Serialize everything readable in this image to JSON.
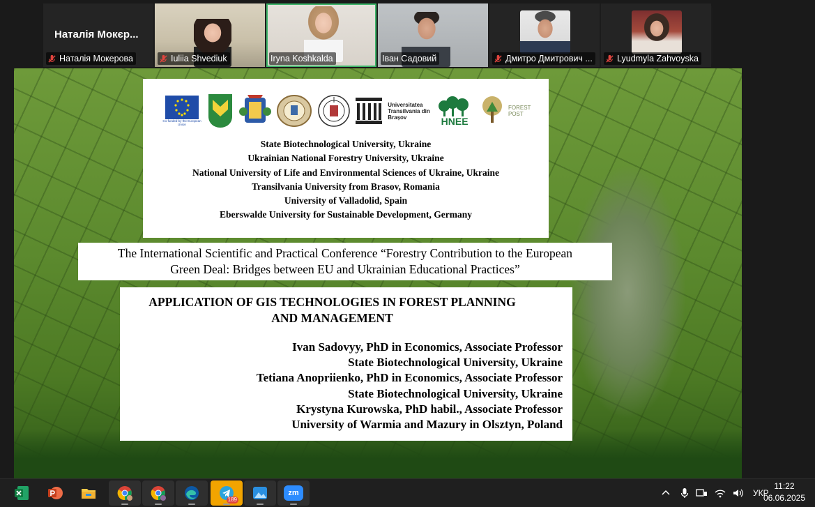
{
  "participants": [
    {
      "name": "Наталія Мокерова",
      "display": "Наталія Мокєр...",
      "muted": true,
      "video": false
    },
    {
      "name": "Iuliia Shvediuk",
      "muted": true,
      "video": true
    },
    {
      "name": "Iryna Koshkalda",
      "muted": false,
      "video": true,
      "active": true
    },
    {
      "name": "Іван Садовий",
      "muted": false,
      "video": true
    },
    {
      "name": "Дмитро Дмитрович ...",
      "muted": true,
      "video": true
    },
    {
      "name": "Lyudmyla Zahvoyska",
      "muted": true,
      "video": true
    }
  ],
  "slide": {
    "logos": [
      "eu-logo",
      "natu-logo",
      "coat-of-arms-logo",
      "seal-logo",
      "valladolid-logo",
      "columns-logo",
      "transilvania-logo",
      "hnee-logo",
      "forest-post-logo"
    ],
    "logo_texts": {
      "eu": "Co-funded by the European Union",
      "transilvania": "Universitatea Transilvania din Brașov",
      "hnee": "HNEE",
      "forest_post": "FOREST POST"
    },
    "universities": [
      "State Biotechnological University, Ukraine",
      "Ukrainian National Forestry University, Ukraine",
      "National University of Life and Environmental Sciences of Ukraine, Ukraine",
      "Transilvania University from Brasov, Romania",
      "University of Valladolid, Spain",
      "Eberswalde University for Sustainable Development, Germany"
    ],
    "conference": [
      "The International Scientific and Practical Conference “Forestry Contribution to the European",
      "Green Deal: Bridges between EU and Ukrainian Educational Practices”"
    ],
    "paper_title": [
      "APPLICATION OF GIS TECHNOLOGIES IN FOREST PLANNING",
      "AND MANAGEMENT"
    ],
    "authors": [
      "Ivan Sadovyy, PhD in Economics, Associate Professor",
      "State Biotechnological University, Ukraine",
      "Tetiana Anopriienko, PhD in Economics, Associate Professor",
      "State Biotechnological University, Ukraine",
      "Krystyna Kurowska, PhD habil., Associate Professor",
      "University of Warmia and Mazury in Olsztyn, Poland"
    ]
  },
  "taskbar": {
    "apps": [
      {
        "name": "excel-icon",
        "open": false
      },
      {
        "name": "powerpoint-icon",
        "open": false
      },
      {
        "name": "file-explorer-icon",
        "open": false
      },
      {
        "name": "chrome-profile-1-icon",
        "open": true
      },
      {
        "name": "chrome-profile-2-icon",
        "open": true
      },
      {
        "name": "edge-icon",
        "open": true
      },
      {
        "name": "telegram-icon",
        "open": true,
        "badge": "189"
      },
      {
        "name": "photos-icon",
        "open": true
      },
      {
        "name": "zoom-icon",
        "open": true,
        "label": "zm"
      }
    ],
    "language": "УКР",
    "time": "11:22",
    "date": "06.06.2025"
  },
  "colors": {
    "active_speaker": "#3fb56a",
    "mute_red": "#e0443e",
    "taskbar": "#1f1f1f"
  }
}
